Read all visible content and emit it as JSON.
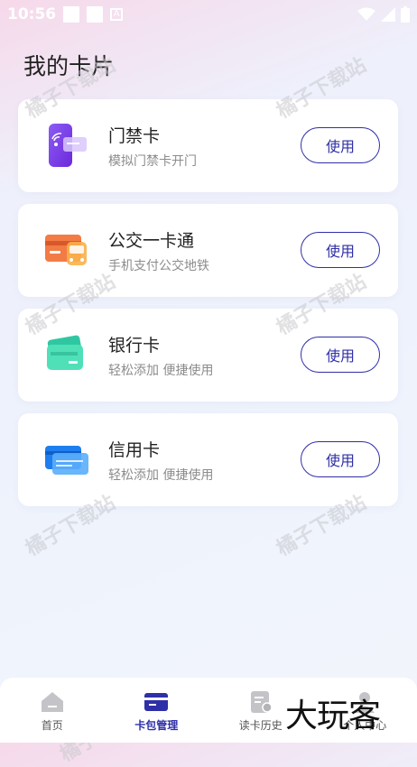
{
  "status_bar": {
    "time": "10:56",
    "a_icon": "A"
  },
  "page_title": "我的卡片",
  "cards": [
    {
      "title": "门禁卡",
      "subtitle": "模拟门禁卡开门",
      "button": "使用",
      "icon": "access-card-icon"
    },
    {
      "title": "公交一卡通",
      "subtitle": "手机支付公交地铁",
      "button": "使用",
      "icon": "bus-card-icon"
    },
    {
      "title": "银行卡",
      "subtitle": "轻松添加 便捷使用",
      "button": "使用",
      "icon": "bank-card-icon"
    },
    {
      "title": "信用卡",
      "subtitle": "轻松添加 便捷使用",
      "button": "使用",
      "icon": "credit-card-icon"
    }
  ],
  "watermark": "橘子下载站",
  "bottom_nav": [
    {
      "label": "首页",
      "icon": "home-icon",
      "active": false
    },
    {
      "label": "卡包管理",
      "icon": "wallet-icon",
      "active": true
    },
    {
      "label": "读卡历史",
      "icon": "history-icon",
      "active": false
    },
    {
      "label": "个人中心",
      "icon": "profile-icon",
      "active": false
    }
  ],
  "brand_overlay": "大玩客",
  "colors": {
    "accent": "#2f2fa8",
    "background_top": "#f6d9ea",
    "background_bottom": "#f3f5fc"
  }
}
